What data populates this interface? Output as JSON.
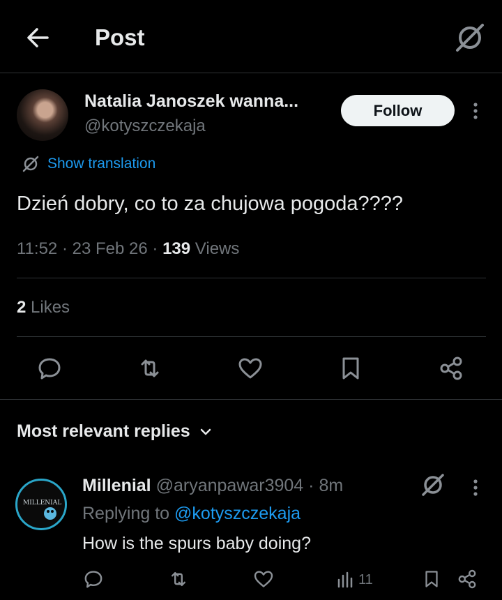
{
  "header": {
    "title": "Post",
    "back_icon": "arrow-left-icon",
    "grok_icon": "grok-icon"
  },
  "post": {
    "author_name": "Natalia Janoszek wanna...",
    "author_handle": "@kotyszczekaja",
    "follow_label": "Follow",
    "translation_label": "Show translation",
    "text": "Dzień dobry, co to za chujowa pogoda????",
    "time": "11:52",
    "date": "23 Feb 26",
    "views_count": "139",
    "views_label": "Views",
    "likes_count": "2",
    "likes_label": "Likes"
  },
  "replies": {
    "heading": "Most relevant replies",
    "items": [
      {
        "name": "Millenial",
        "handle": "@aryanpawar3904",
        "time": "8m",
        "avatar_text": "MILLENIAL",
        "replying_prefix": "Replying to",
        "replying_to": "@kotyszczekaja",
        "text": "How is the spurs baby doing?",
        "views": "11"
      }
    ]
  },
  "colors": {
    "background": "#000000",
    "text": "#e7e9ea",
    "muted": "#71767b",
    "link": "#1d9bf0",
    "divider": "#2f3336",
    "follow_bg": "#eff3f4"
  }
}
